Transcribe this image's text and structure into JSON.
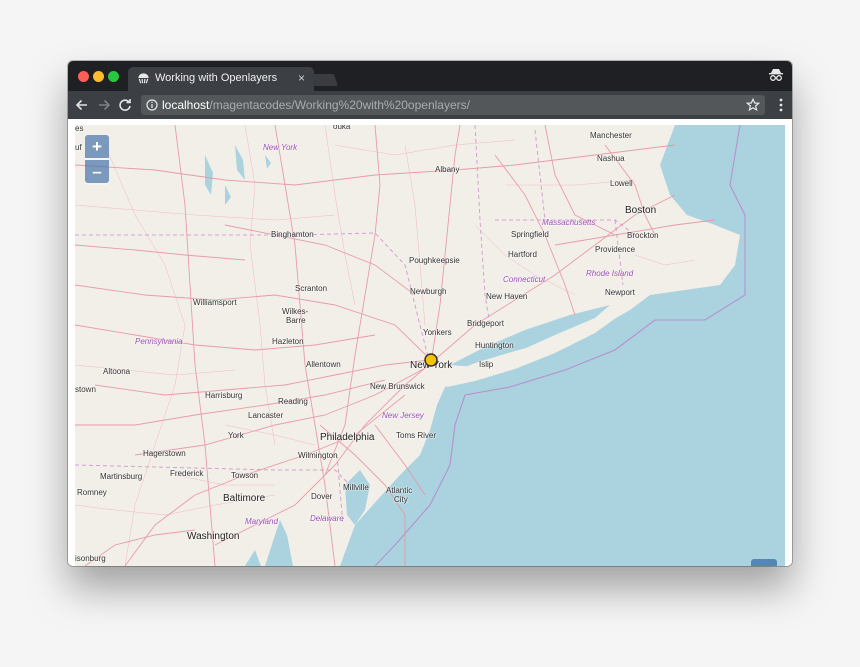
{
  "window": {
    "tab": {
      "title": "Working with Openlayers",
      "close_glyph": "×",
      "icon": "openlayers-favicon"
    },
    "toolbar": {
      "back_icon": "arrow-left-icon",
      "forward_icon": "arrow-right-icon",
      "reload_icon": "reload-icon",
      "url_host": "localhost",
      "url_path": "/magentacodes/Working%20with%20openlayers/",
      "security_icon": "info-icon",
      "bookmark_icon": "star-icon",
      "menu_icon": "vertical-dots-icon",
      "profile_icon": "incognito-icon"
    }
  },
  "map": {
    "zoom_in_label": "+",
    "zoom_out_label": "–",
    "colors": {
      "water": "#aad3df",
      "land": "#f2efe9",
      "road": "#e892a2",
      "border": "#c77fc7",
      "marker": "#f5c400"
    },
    "labels": {
      "top_edge": "ouka",
      "left_edge": "uf",
      "left_edge2": "es",
      "new_york_state": "New York",
      "manchester": "Manchester",
      "nashua": "Nashua",
      "lowell": "Lowell",
      "albany": "Albany",
      "boston": "Boston",
      "massachusetts": "Massachusetts",
      "springfield": "Springfield",
      "brockton": "Brockton",
      "binghamton": "Binghamton",
      "hartford": "Hartford",
      "providence": "Providence",
      "poughkeepsie": "Poughkeepsie",
      "connecticut": "Connecticut",
      "rhode_island": "Rhode Island",
      "scranton": "Scranton",
      "newburgh": "Newburgh",
      "newport": "Newport",
      "williamsport": "Williamsport",
      "new_haven": "New Haven",
      "wilkes_barre_1": "Wilkes-",
      "wilkes_barre_2": "Barre",
      "bridgeport": "Bridgeport",
      "yonkers": "Yonkers",
      "pennsylvania": "Pennsylvania",
      "hazleton": "Hazleton",
      "huntington": "Huntington",
      "allentown": "Allentown",
      "new_york_city": "New York",
      "islip": "Islip",
      "altoona": "Altoona",
      "new_brunswick": "New Brunswick",
      "stown": "stown",
      "harrisburg": "Harrisburg",
      "reading": "Reading",
      "lancaster": "Lancaster",
      "new_jersey": "New Jersey",
      "york": "York",
      "philadelphia": "Philadelphia",
      "toms_river": "Toms River",
      "hagerstown": "Hagerstown",
      "wilmington": "Wilmington",
      "frederick": "Frederick",
      "martinsburg": "Martinsburg",
      "towson": "Towson",
      "millville": "Millville",
      "atlantic_city_1": "Atlantic",
      "atlantic_city_2": "City",
      "romney": "Romney",
      "baltimore": "Baltimore",
      "dover": "Dover",
      "maryland": "Maryland",
      "delaware": "Delaware",
      "washington": "Washington",
      "bottom_left": "isonburg"
    }
  }
}
